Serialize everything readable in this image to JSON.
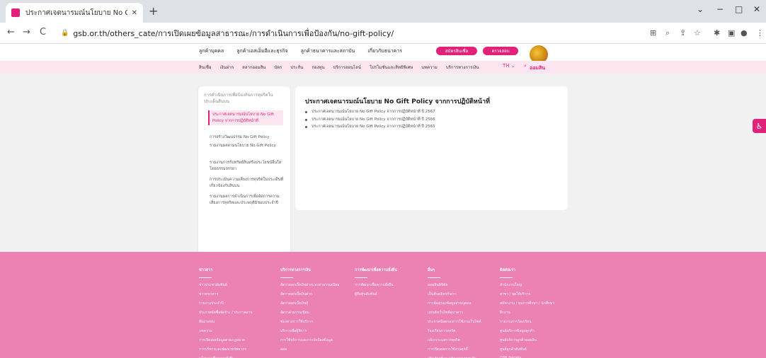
{
  "browser": {
    "tab_title": "ประกาศเจตนารมณ์นโยบาย No Gift P",
    "tab_close": "✕",
    "new_tab": "+",
    "url": "gsb.or.th/others_cate/การเปิดเผยข้อมูลสาธารณะ/การดำเนินการเพื่อป้องกัน/no-gift-policy/",
    "back": "←",
    "forward": "→",
    "reload": "C",
    "minimize": "−",
    "maximize": "□",
    "close": "✕",
    "chevron": "⌄"
  },
  "topnav": {
    "items": [
      "ลูกค้าบุคคล",
      "ลูกค้าเอสเอ็มอีและธุรกิจ",
      "ลูกค้าธนาคารและสถาบัน",
      "เกี่ยวกับธนาคาร"
    ],
    "btn_apply": "สมัครสินเชื่อ",
    "btn_check": "ตรวจสอบ"
  },
  "subnav": {
    "items": [
      "สินเชื่อ",
      "เงินฝาก",
      "สลากออมสิน",
      "บัตร",
      "ประกัน",
      "กองทุน",
      "บริการออนไลน์",
      "โปรโมชั่นและสิทธิพิเศษ",
      "บทความ",
      "บริการทางการเงิน"
    ],
    "lang": "TH ⌄",
    "search": "⌕",
    "logo_text": "ออมสิน"
  },
  "sidebar": {
    "heading": "การดำเนินการเพื่อป้องกันการทุจริตในประเด็นสินบน",
    "items": [
      "ประกาศเจตนารมณ์นโยบาย No Gift Policy จากการปฏิบัติหน้าที่",
      "การสร้างวัฒนธรรม No Gift Policy",
      "รายงานผลตามนโยบาย No Gift Policy",
      "รายงานการรับทรัพย์สินหรือประโยชน์อื่นใดโดยธรรมจรรยา",
      "การประเมินความเสี่ยงการทุจริตในประเด็นที่เกี่ยวข้องกับสินบน",
      "รายงานผลการดำเนินการเพื่อจัดการความเสี่ยงการทุจริตและประพฤติมิชอบประจำปี"
    ]
  },
  "content": {
    "title": "ประกาศเจตนารมณ์นโยบาย No Gift Policy จากการปฏิบัติหน้าที่",
    "items": [
      "ประกาศเจตนารมณ์นโยบาย No Gift Policy จากการปฏิบัติหน้าที่ ปี 2567",
      "ประกาศเจตนารมณ์นโยบาย No Gift Policy จากการปฏิบัติหน้าที่ ปี 2566",
      "ประกาศเจตนารมณ์นโยบาย No Gift Policy จากการปฏิบัติหน้าที่ ปี 2565"
    ]
  },
  "accessibility_icon": "♿",
  "footer": {
    "columns": [
      {
        "heading": "ข่าวสาร",
        "items": [
          "ข่าวประชาสัมพันธ์",
          "ข่าวธนาคาร",
          "รายงานประจำปี",
          "ประกาศจัดซื้อจัดจ้าง / ประกาศงาน",
          "สื่อมวลชน",
          "บทความ",
          "การเปิดเผยข้อมูลตามกฎหมาย",
          "การบริหารและพัฒนาทรัพยากร",
          "นโยบายเพื่อความยั่งยืน"
        ]
      },
      {
        "heading": "บริการทางการเงิน",
        "items": [
          "อัตราดอกเบี้ยเงินฝากและค่าธรรมเนียม",
          "อัตราดอกเบี้ยเงินฝาก",
          "อัตราดอกเบี้ยเงินกู้",
          "อัตราค่าธรรมเนียม",
          "ช่องทางการให้บริการ",
          "บริการเพื่อผู้พิการ",
          "การใช้บริการและการปกป้องข้อมูล",
          "ออม"
        ]
      },
      {
        "heading": "การพัฒนาเพื่อความยั่งยืน",
        "items": [
          "การพัฒนาเพื่อความยั่งยืน",
          "ผู้ถือหุ้นสัมพันธ์"
        ]
      },
      {
        "heading": "อื่นๆ",
        "items": [
          "ออมสินดิจิทัล",
          "เป็นพันธมิตรกับเรา",
          "การคุ้มครองข้อมูลส่วนบุคคล",
          "แผนผังเว็บไซต์ธนาคาร",
          "ประกาศข้อตกลงการใช้งานเว็บไซต์",
          "ร้องเรียนการทุจริต",
          "แจ้งเบาะแสการทุจริต",
          "การเปิดเผยการใช้งานคุกกี้",
          "ผลิตภัณฑ์และบริการทางการเงิน"
        ]
      },
      {
        "heading": "ติดต่อเรา",
        "items": [
          "สำนักงานใหญ่",
          "สาขา / จุดให้บริการ",
          "สมัครงาน / ทุนการศึกษา / นักศึกษา",
          "ฝึกงาน",
          "รายงานการร้องเรียน",
          "ศูนย์บริการข้อมูลลูกค้า",
          "ศูนย์บริการลูกค้าออมสิน",
          "ศูนย์ลูกค้าสัมพันธ์",
          "GSB Society"
        ]
      }
    ]
  },
  "colors": {
    "accent": "#e2227a",
    "footer_bg": "#ec81b3",
    "subnav_bg": "#fde6f0"
  }
}
